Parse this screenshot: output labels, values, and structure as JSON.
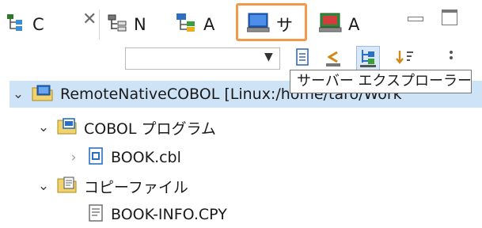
{
  "tabs": [
    {
      "label": "C",
      "icon": "class-hierarchy-icon"
    },
    {
      "label": "N",
      "icon": "navigator-icon"
    },
    {
      "label": "A",
      "icon": "application-tree-icon"
    },
    {
      "label": "サ",
      "icon": "server-explorer-icon"
    },
    {
      "label": "A",
      "icon": "monitor-app-icon"
    }
  ],
  "tooltip": "サーバー エクスプローラー",
  "filter": {
    "value": ""
  },
  "tree": [
    {
      "label": "RemoteNativeCOBOL [Linux:/home/taro/Work",
      "icon": "remote-project-icon",
      "expanded": true
    },
    {
      "label": "COBOL プログラム",
      "icon": "cobol-program-folder-icon",
      "expanded": true
    },
    {
      "label": "BOOK.cbl",
      "icon": "cobol-source-file-icon",
      "expanded": false
    },
    {
      "label": "コピーファイル",
      "icon": "copybook-folder-icon",
      "expanded": true
    },
    {
      "label": "BOOK-INFO.CPY",
      "icon": "copybook-file-icon"
    }
  ],
  "colors": {
    "highlight": "#f39a4a",
    "selection": "#cfe3f7"
  }
}
